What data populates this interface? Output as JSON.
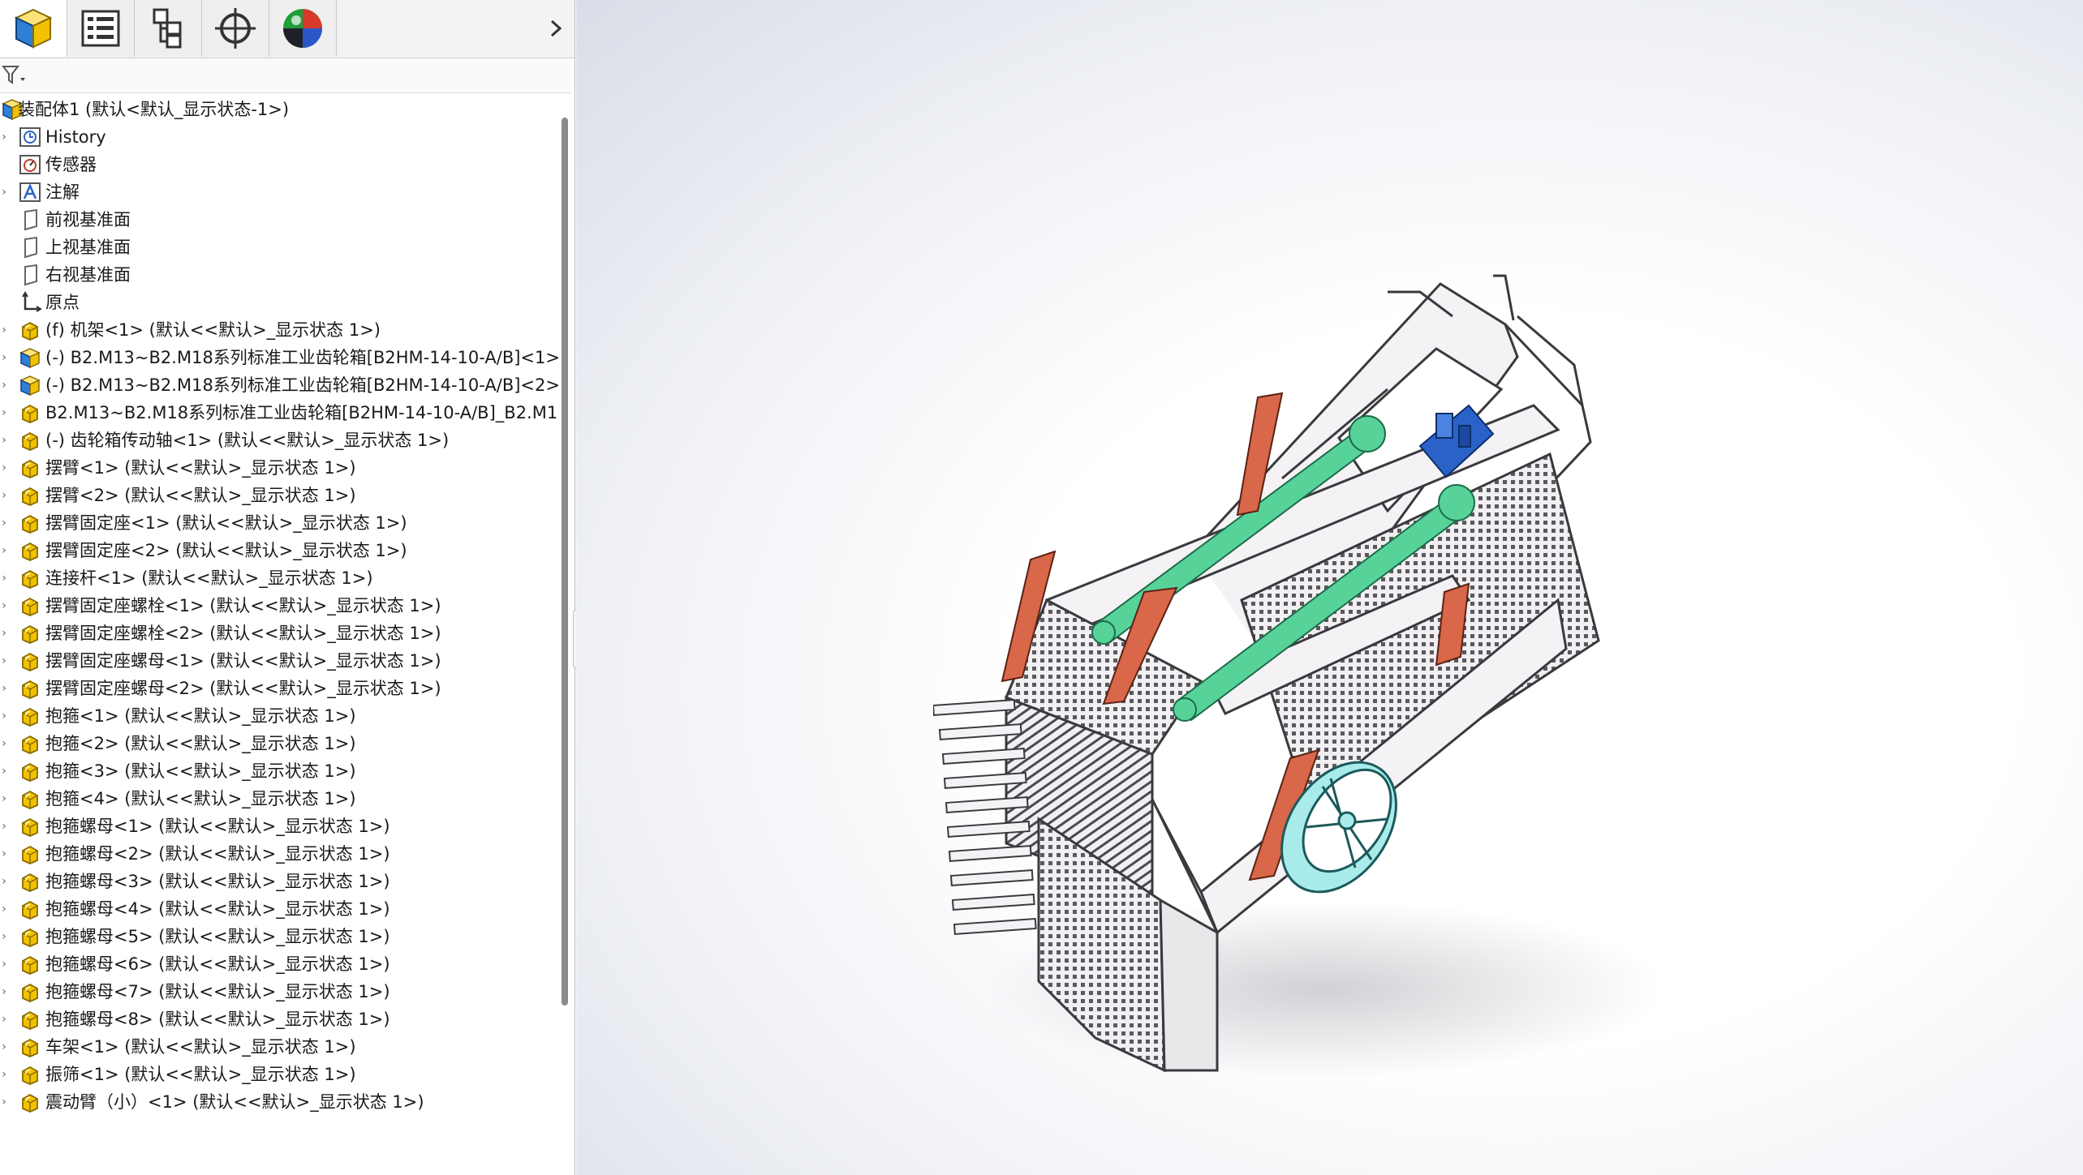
{
  "panel": {
    "tabs": [
      {
        "name": "feature-manager-tab",
        "icon": "assembly-cube-icon",
        "active": true
      },
      {
        "name": "property-manager-tab",
        "icon": "property-list-icon",
        "active": false
      },
      {
        "name": "configuration-manager-tab",
        "icon": "configuration-icon",
        "active": false
      },
      {
        "name": "dimxpert-tab",
        "icon": "crosshair-icon",
        "active": false
      },
      {
        "name": "display-manager-tab",
        "icon": "appearance-sphere-icon",
        "active": false
      }
    ],
    "more_tabs_icon": "chevron-right-icon",
    "filter_icon": "filter-icon"
  },
  "tree": {
    "root": "装配体1  (默认<默认_显示状态-1>)",
    "items": [
      {
        "label": "History",
        "icon": "history-icon",
        "expandable": true
      },
      {
        "label": "传感器",
        "icon": "sensor-icon",
        "expandable": false
      },
      {
        "label": "注解",
        "icon": "annotation-icon",
        "expandable": true
      },
      {
        "label": "前视基准面",
        "icon": "plane-icon",
        "expandable": false
      },
      {
        "label": "上视基准面",
        "icon": "plane-icon",
        "expandable": false
      },
      {
        "label": "右视基准面",
        "icon": "plane-icon",
        "expandable": false
      },
      {
        "label": "原点",
        "icon": "origin-icon",
        "expandable": false
      },
      {
        "label": "(f) 机架<1> (默认<<默认>_显示状态 1>)",
        "icon": "part-icon",
        "expandable": true
      },
      {
        "label": "(-) B2.M13~B2.M18系列标准工业齿轮箱[B2HM-14-10-A∕B]<1>",
        "icon": "subassembly-icon",
        "expandable": true
      },
      {
        "label": "(-) B2.M13~B2.M18系列标准工业齿轮箱[B2HM-14-10-A∕B]<2>",
        "icon": "subassembly-icon",
        "expandable": true
      },
      {
        "label": "B2.M13~B2.M18系列标准工业齿轮箱[B2HM-14-10-A∕B]_B2.M1",
        "icon": "part-icon",
        "expandable": true
      },
      {
        "label": "(-) 齿轮箱传动轴<1> (默认<<默认>_显示状态 1>)",
        "icon": "part-icon",
        "expandable": true
      },
      {
        "label": "摆臂<1> (默认<<默认>_显示状态 1>)",
        "icon": "part-icon",
        "expandable": true
      },
      {
        "label": "摆臂<2> (默认<<默认>_显示状态 1>)",
        "icon": "part-icon",
        "expandable": true
      },
      {
        "label": "摆臂固定座<1> (默认<<默认>_显示状态 1>)",
        "icon": "part-icon",
        "expandable": true
      },
      {
        "label": "摆臂固定座<2> (默认<<默认>_显示状态 1>)",
        "icon": "part-icon",
        "expandable": true
      },
      {
        "label": "连接杆<1> (默认<<默认>_显示状态 1>)",
        "icon": "part-icon",
        "expandable": true
      },
      {
        "label": "摆臂固定座螺栓<1> (默认<<默认>_显示状态 1>)",
        "icon": "part-icon",
        "expandable": true
      },
      {
        "label": "摆臂固定座螺栓<2> (默认<<默认>_显示状态 1>)",
        "icon": "part-icon",
        "expandable": true
      },
      {
        "label": "摆臂固定座螺母<1> (默认<<默认>_显示状态 1>)",
        "icon": "part-icon",
        "expandable": true
      },
      {
        "label": "摆臂固定座螺母<2> (默认<<默认>_显示状态 1>)",
        "icon": "part-icon",
        "expandable": true
      },
      {
        "label": "抱箍<1> (默认<<默认>_显示状态 1>)",
        "icon": "part-icon",
        "expandable": true
      },
      {
        "label": "抱箍<2> (默认<<默认>_显示状态 1>)",
        "icon": "part-icon",
        "expandable": true
      },
      {
        "label": "抱箍<3> (默认<<默认>_显示状态 1>)",
        "icon": "part-icon",
        "expandable": true
      },
      {
        "label": "抱箍<4> (默认<<默认>_显示状态 1>)",
        "icon": "part-icon",
        "expandable": true
      },
      {
        "label": "抱箍螺母<1> (默认<<默认>_显示状态 1>)",
        "icon": "part-icon",
        "expandable": true
      },
      {
        "label": "抱箍螺母<2> (默认<<默认>_显示状态 1>)",
        "icon": "part-icon",
        "expandable": true
      },
      {
        "label": "抱箍螺母<3> (默认<<默认>_显示状态 1>)",
        "icon": "part-icon",
        "expandable": true
      },
      {
        "label": "抱箍螺母<4> (默认<<默认>_显示状态 1>)",
        "icon": "part-icon",
        "expandable": true
      },
      {
        "label": "抱箍螺母<5> (默认<<默认>_显示状态 1>)",
        "icon": "part-icon",
        "expandable": true
      },
      {
        "label": "抱箍螺母<6> (默认<<默认>_显示状态 1>)",
        "icon": "part-icon",
        "expandable": true
      },
      {
        "label": "抱箍螺母<7> (默认<<默认>_显示状态 1>)",
        "icon": "part-icon",
        "expandable": true
      },
      {
        "label": "抱箍螺母<8> (默认<<默认>_显示状态 1>)",
        "icon": "part-icon",
        "expandable": true
      },
      {
        "label": "车架<1> (默认<<默认>_显示状态 1>)",
        "icon": "part-icon",
        "expandable": true
      },
      {
        "label": "振筛<1> (默认<<默认>_显示状态 1>)",
        "icon": "part-icon",
        "expandable": true
      },
      {
        "label": "震动臂（小）<1> (默认<<默认>_显示状态 1>)",
        "icon": "part-icon",
        "expandable": true
      }
    ]
  },
  "colors": {
    "part_icon": "#f2c200",
    "subassembly_icon": "#2a7fd4",
    "frame": "#f4f2f5",
    "arm_green": "#57d39a",
    "bracket_orange": "#d9674a",
    "wheel_cyan": "#a9eaea",
    "gearbox_blue": "#2a62c8"
  }
}
